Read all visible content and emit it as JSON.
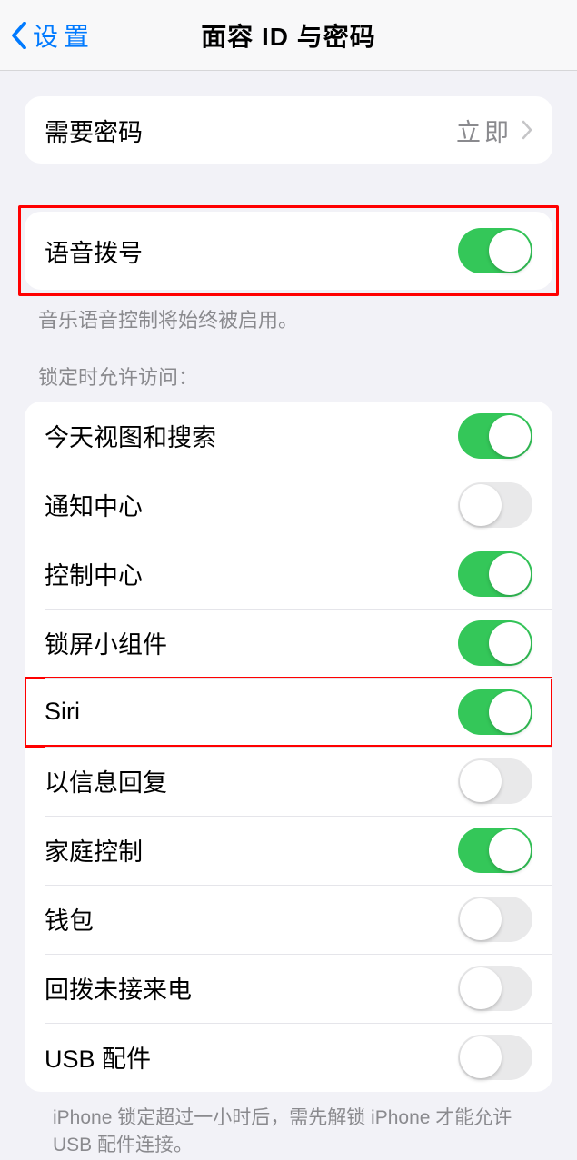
{
  "header": {
    "back_label": "设置",
    "title": "面容 ID 与密码"
  },
  "require_passcode": {
    "label": "需要密码",
    "value": "立即"
  },
  "voice_dial": {
    "label": "语音拨号",
    "caption": "音乐语音控制将始终被启用。"
  },
  "lock_access": {
    "header": "锁定时允许访问：",
    "items": [
      {
        "label": "今天视图和搜索",
        "on": true
      },
      {
        "label": "通知中心",
        "on": false
      },
      {
        "label": "控制中心",
        "on": true
      },
      {
        "label": "锁屏小组件",
        "on": true
      },
      {
        "label": "Siri",
        "on": true
      },
      {
        "label": "以信息回复",
        "on": false
      },
      {
        "label": "家庭控制",
        "on": true
      },
      {
        "label": "钱包",
        "on": false
      },
      {
        "label": "回拨未接来电",
        "on": false
      },
      {
        "label": "USB 配件",
        "on": false
      }
    ],
    "footer": "iPhone 锁定超过一小时后，需先解锁 iPhone 才能允许USB 配件连接。"
  }
}
